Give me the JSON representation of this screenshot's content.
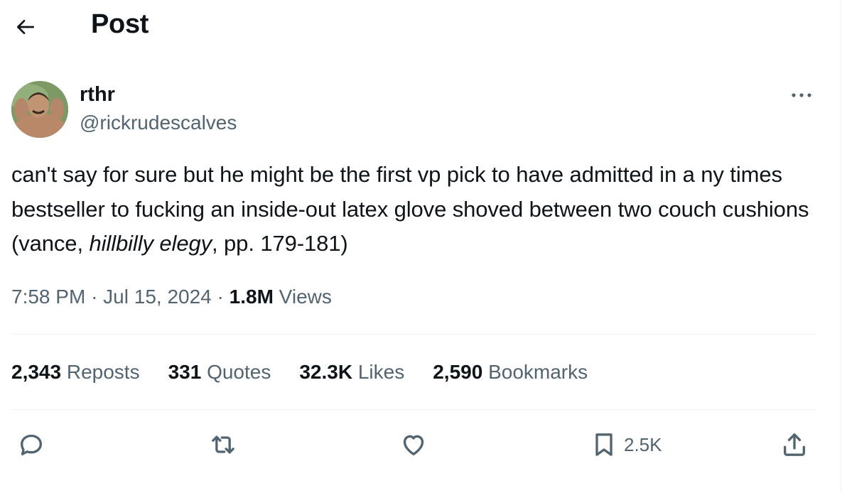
{
  "header": {
    "title": "Post",
    "back_icon": "arrow-left-icon"
  },
  "author": {
    "name": "rthr",
    "handle": "@rickrudescalves",
    "avatar_icon": "avatar-photo"
  },
  "tweet": {
    "text_before": "can't say for sure but he might be the first vp pick to have admitted in a ny times bestseller to fucking an inside-out latex glove shoved between two couch cushions (vance, ",
    "text_italic": "hillbilly elegy",
    "text_after": ", pp. 179-181)"
  },
  "meta": {
    "time": "7:58 PM",
    "separator": "·",
    "date": "Jul 15, 2024",
    "views_count": "1.8M",
    "views_label": "Views"
  },
  "stats": {
    "reposts_count": "2,343",
    "reposts_label": "Reposts",
    "quotes_count": "331",
    "quotes_label": "Quotes",
    "likes_count": "32.3K",
    "likes_label": "Likes",
    "bookmarks_count": "2,590",
    "bookmarks_label": "Bookmarks"
  },
  "actions": {
    "reply_icon": "reply-icon",
    "repost_icon": "repost-icon",
    "like_icon": "heart-icon",
    "bookmark_icon": "bookmark-icon",
    "bookmark_count": "2.5K",
    "share_icon": "share-icon"
  },
  "colors": {
    "text": "#0f1419",
    "secondary": "#536471",
    "divider": "#eff3f4"
  }
}
